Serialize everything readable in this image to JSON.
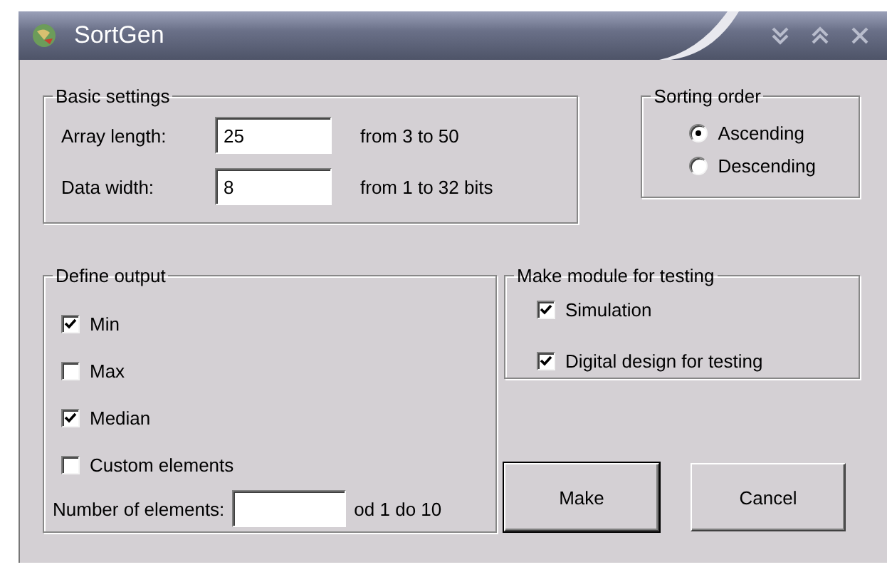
{
  "window": {
    "title": "SortGen"
  },
  "basic_settings": {
    "title": "Basic settings",
    "fields": [
      {
        "label": "Array length:",
        "value": "25",
        "hint": "from 3 to 50"
      },
      {
        "label": "Data width:",
        "value": "8",
        "hint": "from 1 to 32 bits"
      }
    ]
  },
  "sorting_order": {
    "title": "Sorting order",
    "options": [
      {
        "label": "Ascending",
        "selected": true
      },
      {
        "label": "Descending",
        "selected": false
      }
    ]
  },
  "define_output": {
    "title": "Define output",
    "options": [
      {
        "label": "Min",
        "checked": true
      },
      {
        "label": "Max",
        "checked": false
      },
      {
        "label": "Median",
        "checked": true
      },
      {
        "label": "Custom elements",
        "checked": false
      }
    ],
    "count_field": {
      "label": "Number of elements:",
      "hint": "od 1 do 10"
    }
  },
  "test_module": {
    "title": "Make module for testing",
    "options": [
      {
        "label": "Simulation",
        "checked": true
      },
      {
        "label": "Digital design for testing",
        "checked": true
      }
    ]
  },
  "buttons": [
    {
      "label": "Make",
      "default": true
    },
    {
      "label": "Cancel",
      "default": false
    }
  ]
}
